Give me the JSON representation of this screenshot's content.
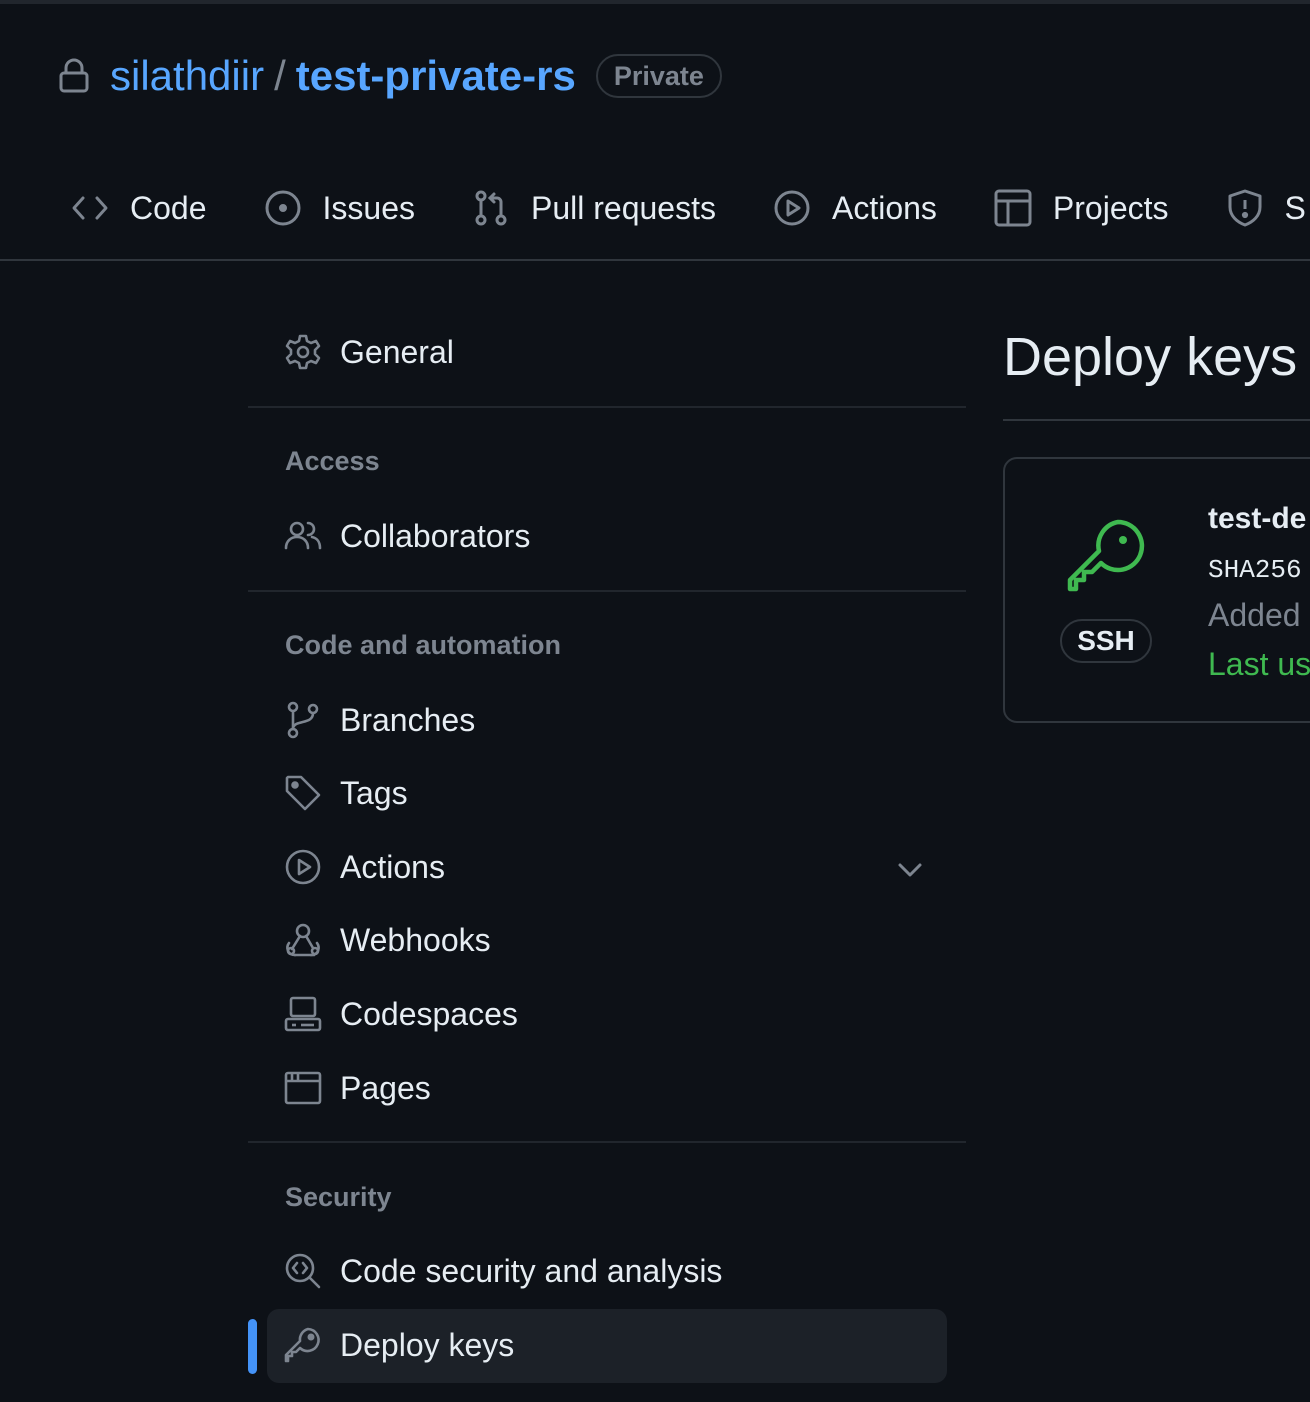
{
  "repo": {
    "owner": "silathdiir",
    "separator": "/",
    "name": "test-private-rs",
    "visibility": "Private"
  },
  "tabs": [
    {
      "label": "Code",
      "icon": "code-icon"
    },
    {
      "label": "Issues",
      "icon": "issue-opened-icon"
    },
    {
      "label": "Pull requests",
      "icon": "git-pull-request-icon"
    },
    {
      "label": "Actions",
      "icon": "play-icon"
    },
    {
      "label": "Projects",
      "icon": "table-icon"
    },
    {
      "label": "S",
      "icon": "shield-icon"
    }
  ],
  "sidebar": {
    "general": {
      "label": "General",
      "icon": "gear-icon"
    },
    "groups": [
      {
        "heading": "Access",
        "items": [
          {
            "label": "Collaborators",
            "icon": "people-icon"
          }
        ]
      },
      {
        "heading": "Code and automation",
        "items": [
          {
            "label": "Branches",
            "icon": "git-branch-icon"
          },
          {
            "label": "Tags",
            "icon": "tag-icon"
          },
          {
            "label": "Actions",
            "icon": "play-icon",
            "expandable": true
          },
          {
            "label": "Webhooks",
            "icon": "webhook-icon"
          },
          {
            "label": "Codespaces",
            "icon": "codespaces-icon"
          },
          {
            "label": "Pages",
            "icon": "browser-icon"
          }
        ]
      },
      {
        "heading": "Security",
        "items": [
          {
            "label": "Code security and analysis",
            "icon": "codescan-icon"
          },
          {
            "label": "Deploy keys",
            "icon": "key-icon",
            "active": true
          }
        ]
      }
    ]
  },
  "main": {
    "title": "Deploy keys",
    "key": {
      "type_label": "SSH",
      "title": "test-de",
      "fingerprint": "SHA256",
      "added": "Added",
      "last_used": "Last us"
    }
  },
  "colors": {
    "background": "#0d1117",
    "link": "#58a6ff",
    "muted": "#7d8590",
    "success": "#3fb950",
    "active_indicator": "#4493f8",
    "border": "#30363d"
  }
}
